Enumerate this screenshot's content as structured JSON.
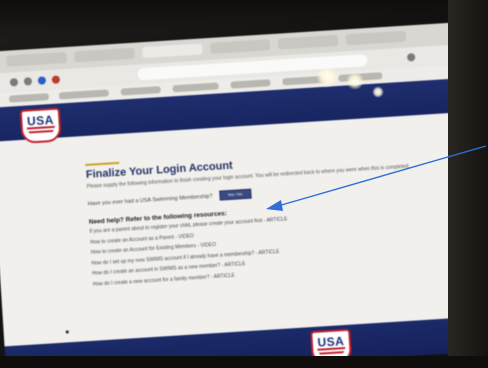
{
  "page": {
    "title": "Finalize Your Login Account",
    "intro": "Please supply the following information to finish creating your login account. You will be redirected back to where you were when this is completed.",
    "question": "Have you ever had a USA Swimming Membership?",
    "select_value": "Yes / No"
  },
  "help": {
    "heading": "Need help? Refer to the following resources:",
    "items": [
      "If you are a parent about to register your child, please create your account first - ARTICLE",
      "How to create an Account as a Parent - VIDEO",
      "How to create an Account for Existing Members - VIDEO",
      "How do I set up my new SWIMS account if I already have a membership? - ARTICLE",
      "How do I create an account in SWIMS as a new member? - ARTICLE",
      "How do I create a new account for a family member? - ARTICLE"
    ]
  },
  "branding": {
    "logo_text": "USA"
  },
  "colors": {
    "header_navy": "#1f2e6e",
    "accent_gold": "#c9a227",
    "logo_red": "#c21f2a",
    "arrow_blue": "#2f6fd6"
  },
  "icons": [
    "browser-tab-icon",
    "back-icon",
    "forward-icon",
    "reload-icon",
    "usa-swimming-logo",
    "annotation-arrow"
  ]
}
